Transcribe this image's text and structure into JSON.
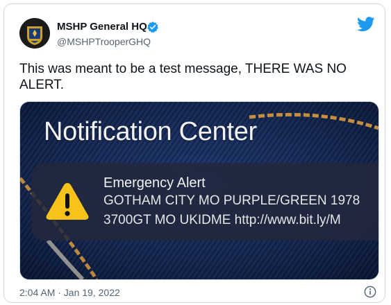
{
  "author": {
    "name": "MSHP General HQ",
    "handle": "@MSHPTrooperGHQ"
  },
  "tweet": {
    "text": "This was meant to be a test message, THERE WAS NO ALERT."
  },
  "media": {
    "title": "Notification Center",
    "alert_title": "Emergency Alert",
    "line1": "GOTHAM CITY MO PURPLE/GREEN 1978",
    "line2": "3700GT MO UKIDME  http://www.bit.ly/M"
  },
  "meta": {
    "timestamp": "2:04 AM · Jan 19, 2022"
  },
  "icons": {
    "verified": "verified-badge-icon",
    "platform": "twitter-bird-icon",
    "warning": "warning-triangle-icon",
    "info": "info-icon"
  },
  "colors": {
    "brand": "#1d9bf0",
    "text": "#0f1419",
    "muted": "#536471",
    "alert_yellow": "#f7c21a"
  }
}
